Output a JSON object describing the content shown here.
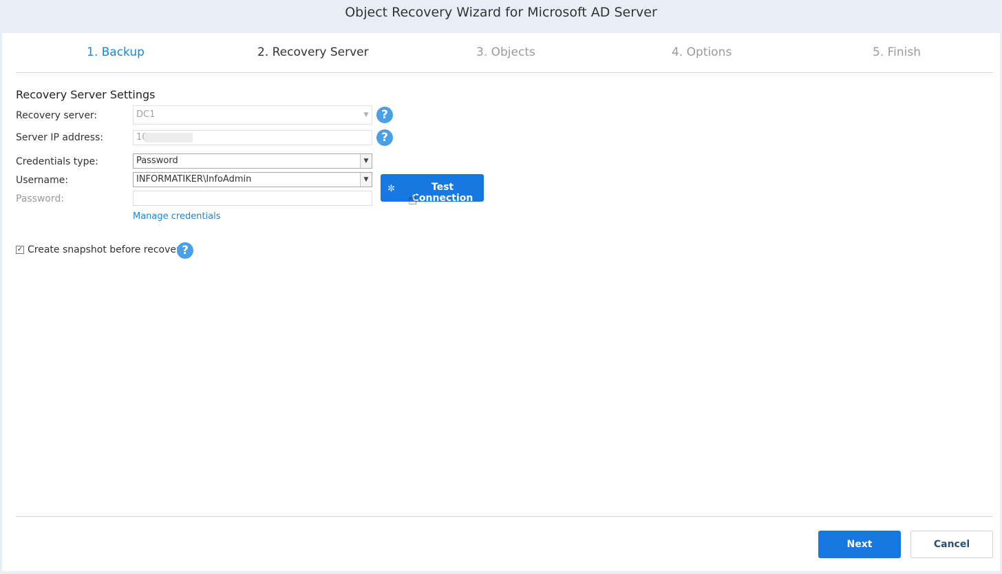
{
  "window": {
    "title": "Object Recovery Wizard for Microsoft AD Server"
  },
  "steps": [
    {
      "label": "1. Backup",
      "state": "done"
    },
    {
      "label": "2. Recovery Server",
      "state": "active"
    },
    {
      "label": "3. Objects",
      "state": "pending"
    },
    {
      "label": "4. Options",
      "state": "pending"
    },
    {
      "label": "5. Finish",
      "state": "pending"
    }
  ],
  "settings": {
    "section_title": "Recovery Server Settings",
    "recovery_server": {
      "label": "Recovery server:",
      "value": "DC1"
    },
    "server_ip": {
      "label": "Server IP address:",
      "value": "10"
    },
    "credentials_type": {
      "label": "Credentials type:",
      "value": "Password"
    },
    "username": {
      "label": "Username:",
      "value": "INFORMATIKER\\InfoAdmin"
    },
    "password": {
      "label": "Password:",
      "value": ""
    },
    "manage_credentials": "Manage credentials",
    "test_connection": "Test Connection",
    "snapshot": {
      "label": "Create snapshot before recovery",
      "checked": true
    }
  },
  "footer": {
    "next": "Next",
    "cancel": "Cancel"
  },
  "colors": {
    "accent": "#1678e0",
    "help_icon": "#4a9fe6",
    "link": "#1a86d8"
  },
  "icons": {
    "help": "question-circle-icon",
    "dropdown": "chevron-down-icon",
    "spinner": "loading-spinner-icon",
    "cursor": "hand-pointer-icon",
    "check": "checkmark-icon"
  }
}
